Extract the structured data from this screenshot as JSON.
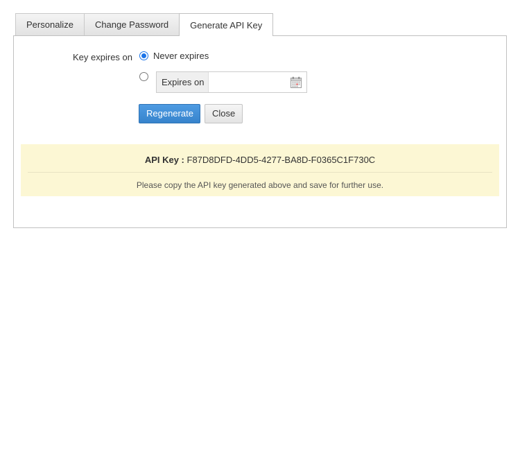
{
  "tabs": [
    {
      "label": "Personalize",
      "active": false
    },
    {
      "label": "Change Password",
      "active": false
    },
    {
      "label": "Generate API Key",
      "active": true
    }
  ],
  "form": {
    "expiry_label": "Key expires on",
    "option_never": "Never expires",
    "option_never_selected": true,
    "option_expires_selected": false,
    "expires_on_label": "Expires on",
    "expires_on_value": "",
    "calendar_icon": "calendar-icon"
  },
  "buttons": {
    "regenerate": "Regenerate",
    "close": "Close"
  },
  "api": {
    "key_label": "API Key :",
    "key_value": "F87D8DFD-4DD5-4277-BA8D-F0365C1F730C",
    "note": "Please copy the API key generated above and save for further use."
  },
  "colors": {
    "primary": "#3a8bd6",
    "notice_bg": "#fcf7d4",
    "radio_accent": "#1a73e8"
  }
}
